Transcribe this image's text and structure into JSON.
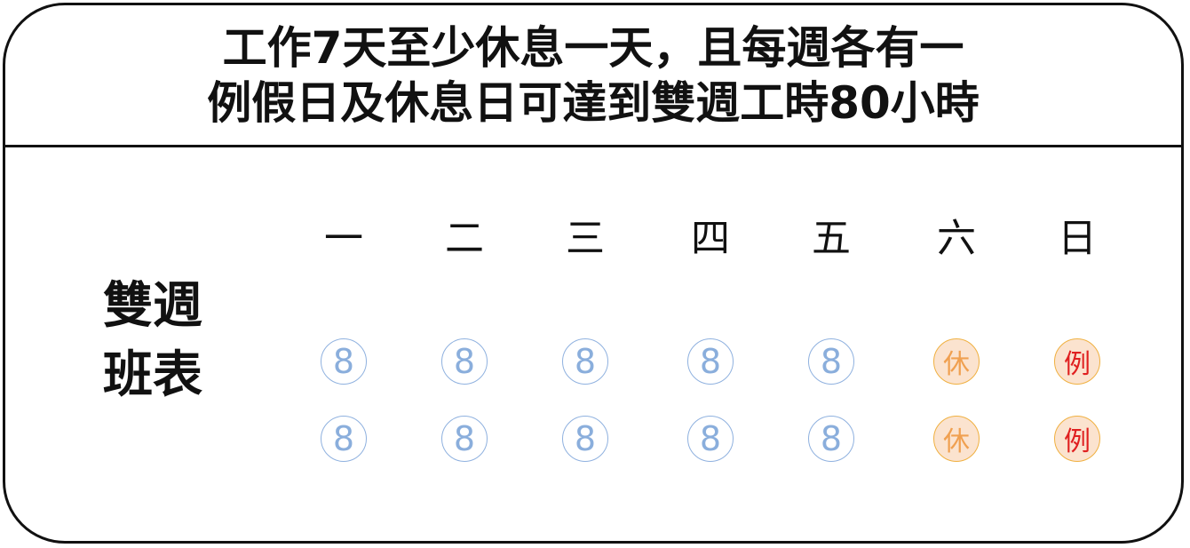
{
  "title": {
    "line1": "工作7天至少休息一天，且每週各有一",
    "line2": "例假日及休息日可達到雙週工時80小時"
  },
  "side_label": {
    "line1": "雙週",
    "line2": "班表"
  },
  "days": [
    "一",
    "二",
    "三",
    "四",
    "五",
    "六",
    "日"
  ],
  "schedule": {
    "week1": [
      "8",
      "8",
      "8",
      "8",
      "8",
      "休",
      "例"
    ],
    "week2": [
      "8",
      "8",
      "8",
      "8",
      "8",
      "休",
      "例"
    ]
  },
  "colors": {
    "work_border": "#8fb1df",
    "work_text": "#8aaedc",
    "off_fill": "#fbe3cf",
    "off_border": "#f0b040",
    "rest_text": "#f0a050",
    "regular_leave_text": "#e02020"
  }
}
